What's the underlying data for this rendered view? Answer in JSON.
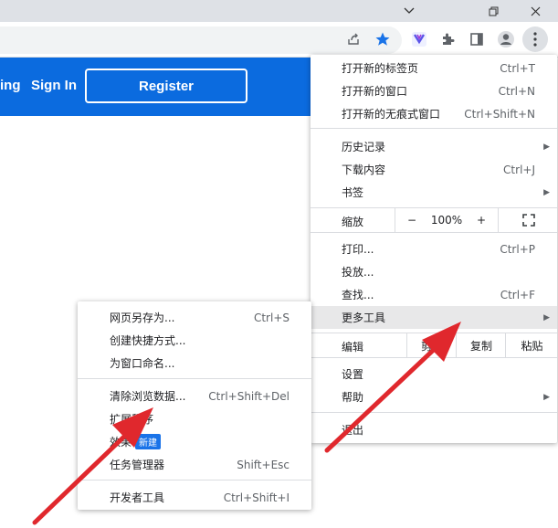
{
  "colors": {
    "brand": "#0b6bdf",
    "accent": "#1a73e8",
    "annotation": "#e0282d"
  },
  "window": {
    "titlebar_icons": [
      "chevron-down-icon",
      "restore-icon",
      "close-icon"
    ]
  },
  "toolbar": {
    "icons": [
      "share-icon",
      "star-icon",
      "extension-app-icon",
      "puzzle-icon",
      "sidebar-icon",
      "profile-icon",
      "kebab-menu-icon"
    ]
  },
  "page": {
    "nav_partial": "ing",
    "sign_in": "Sign In",
    "register": "Register"
  },
  "main_menu": {
    "new_tab": {
      "label": "打开新的标签页",
      "shortcut": "Ctrl+T"
    },
    "new_window": {
      "label": "打开新的窗口",
      "shortcut": "Ctrl+N"
    },
    "new_incognito": {
      "label": "打开新的无痕式窗口",
      "shortcut": "Ctrl+Shift+N"
    },
    "history": {
      "label": "历史记录"
    },
    "downloads": {
      "label": "下载内容",
      "shortcut": "Ctrl+J"
    },
    "bookmarks": {
      "label": "书签"
    },
    "zoom": {
      "label": "缩放",
      "minus": "−",
      "value": "100%",
      "plus": "+"
    },
    "print": {
      "label": "打印...",
      "shortcut": "Ctrl+P"
    },
    "cast": {
      "label": "投放..."
    },
    "find": {
      "label": "查找...",
      "shortcut": "Ctrl+F"
    },
    "more_tools": {
      "label": "更多工具"
    },
    "edit": {
      "label": "编辑",
      "cut": "剪切",
      "copy": "复制",
      "paste": "粘贴"
    },
    "settings": {
      "label": "设置"
    },
    "help": {
      "label": "帮助"
    },
    "exit": {
      "label": "退出"
    }
  },
  "sub_menu": {
    "save_as": {
      "label": "网页另存为...",
      "shortcut": "Ctrl+S"
    },
    "create_shortcut": {
      "label": "创建快捷方式..."
    },
    "name_window": {
      "label": "为窗口命名..."
    },
    "clear_data": {
      "label": "清除浏览数据...",
      "shortcut": "Ctrl+Shift+Del"
    },
    "extensions": {
      "label": "扩展程序"
    },
    "performance": {
      "label": "效果",
      "badge": "新建"
    },
    "task_manager": {
      "label": "任务管理器",
      "shortcut": "Shift+Esc"
    },
    "dev_tools": {
      "label": "开发者工具",
      "shortcut": "Ctrl+Shift+I"
    }
  }
}
